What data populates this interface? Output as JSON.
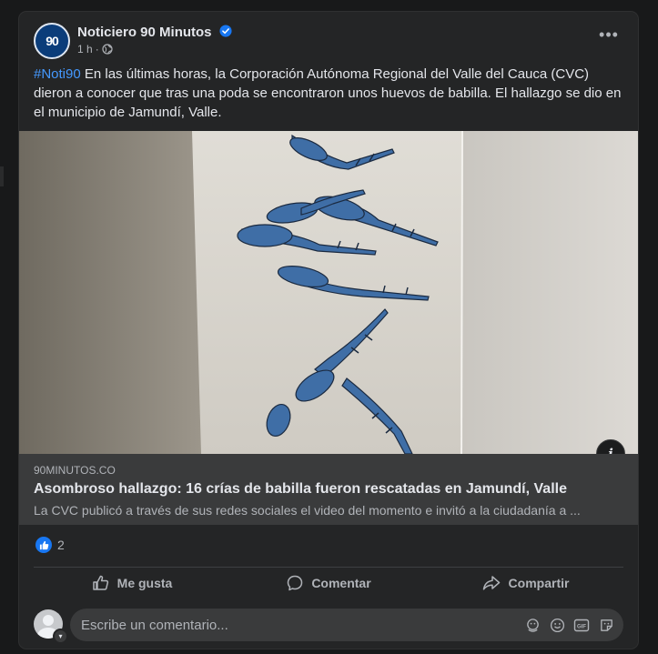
{
  "post": {
    "page_name": "Noticiero 90 Minutos",
    "avatar_text": "90",
    "time": "1 h",
    "separator": "·",
    "hashtag": "#Noti90",
    "body": " En las últimas horas, la Corporación Autónoma Regional del Valle del Cauca (CVC) dieron a conocer que tras una poda se encontraron unos huevos de babilla. El hallazgo se dio en el municipio de Jamundí, Valle.",
    "more_label": "•••"
  },
  "link": {
    "domain": "90MINUTOS.CO",
    "title": "Asombroso hallazgo: 16 crías de babilla fueron rescatadas en Jamundí, Valle",
    "description": "La CVC publicó a través de sus redes sociales el video del momento e invitó a la ciudadanía a ...",
    "info_label": "i"
  },
  "reactions": {
    "count": "2"
  },
  "actions": {
    "like": "Me gusta",
    "comment": "Comentar",
    "share": "Compartir"
  },
  "comment_box": {
    "placeholder": "Escribe un comentario..."
  },
  "colors": {
    "accent": "#1877f2",
    "hashtag": "#4599ff",
    "card": "#242526",
    "background": "#18191a"
  }
}
